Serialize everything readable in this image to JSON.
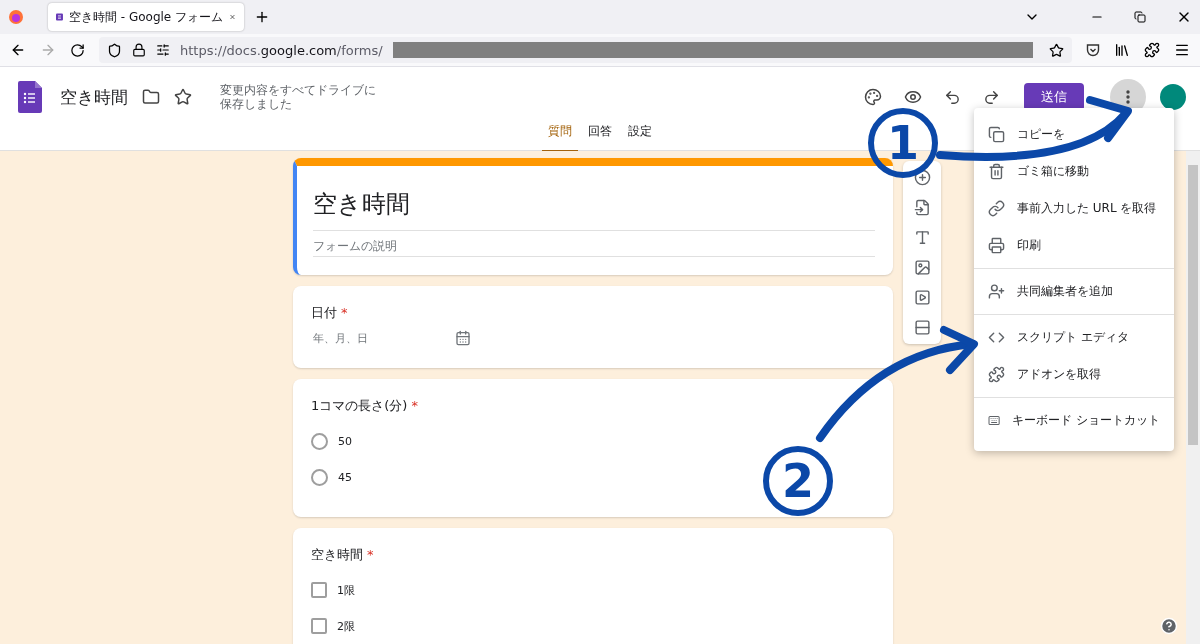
{
  "browser": {
    "tab": {
      "title": "空き時間 - Google フォーム",
      "selected": true
    },
    "url": {
      "prefix": "https://docs.",
      "host": "google.com",
      "path": "/forms/"
    }
  },
  "header": {
    "title": "空き時間",
    "save_status": [
      "変更内容をすべてドライブに",
      "保存しました"
    ],
    "send_button": "送信"
  },
  "tabs": [
    {
      "label": "質問",
      "selected": true
    },
    {
      "label": "回答",
      "selected": false
    },
    {
      "label": "設定",
      "selected": false
    }
  ],
  "form": {
    "title": "空き時間",
    "description_placeholder": "フォームの説明"
  },
  "questions": [
    {
      "kind": "date",
      "title": "日付",
      "required_mark": "*",
      "placeholder": "年、月、日"
    },
    {
      "kind": "radio",
      "title": "1コマの長さ(分)",
      "required_mark": "*",
      "options": [
        {
          "label": "50",
          "selected": false
        },
        {
          "label": "45",
          "selected": false
        }
      ]
    },
    {
      "kind": "checkbox",
      "title": "空き時間",
      "required_mark": "*",
      "options": [
        {
          "label": "1限",
          "checked": false
        },
        {
          "label": "2限",
          "checked": false
        }
      ]
    }
  ],
  "menu": {
    "groups": [
      [
        {
          "kind": "copy",
          "label": "コピーを"
        },
        {
          "kind": "trash",
          "label": "ゴミ箱に移動"
        },
        {
          "kind": "link",
          "label": "事前入力した URL を取得"
        },
        {
          "kind": "print",
          "label": "印刷"
        }
      ],
      [
        {
          "kind": "collaborator",
          "label": "共同編集者を追加"
        }
      ],
      [
        {
          "kind": "code",
          "label": "スクリプト エディタ"
        },
        {
          "kind": "addon",
          "label": "アドオンを取得"
        }
      ],
      [
        {
          "kind": "keyboard",
          "label": "キーボード ショートカット"
        }
      ]
    ]
  },
  "annotations": [
    {
      "label": "1"
    },
    {
      "label": "2"
    }
  ]
}
